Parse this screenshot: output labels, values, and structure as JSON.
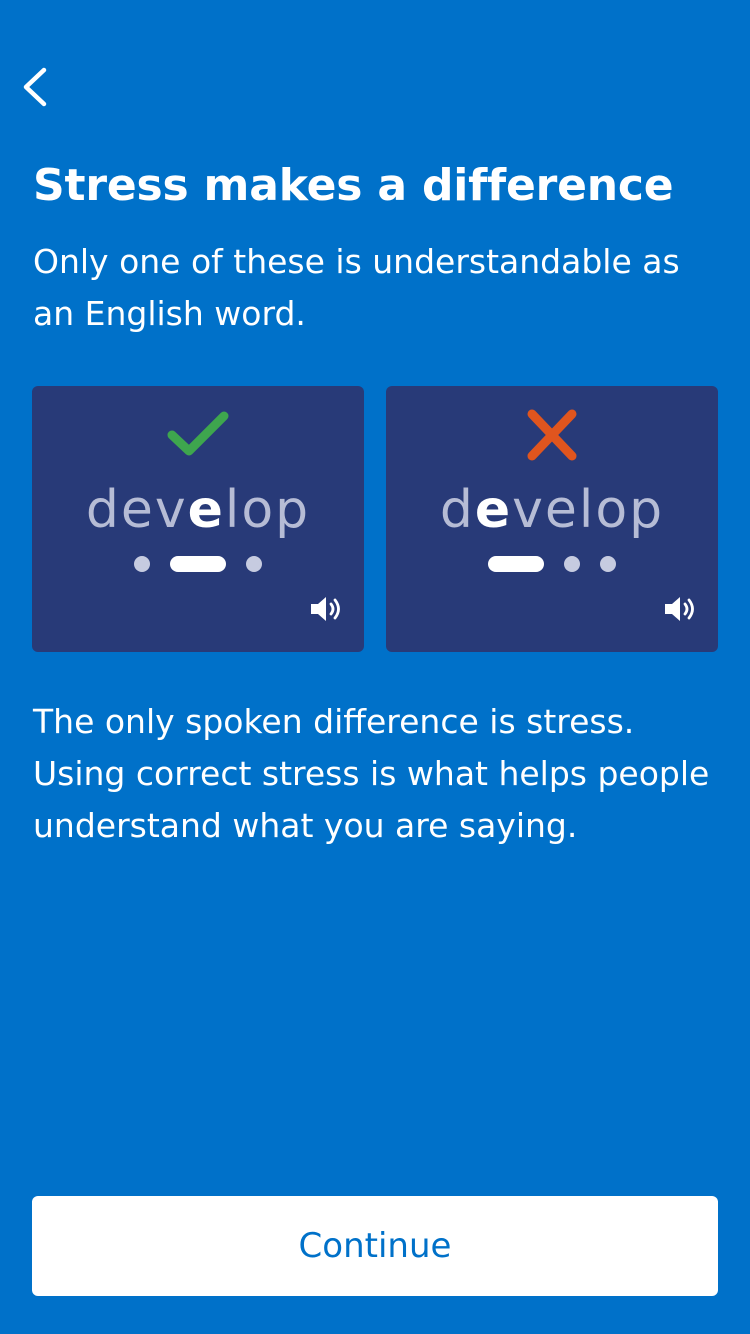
{
  "header": {
    "back_icon": "chevron-left-icon"
  },
  "title": "Stress makes a difference",
  "subtitle": "Only one of these is understandable as an English word.",
  "options": [
    {
      "status_icon": "checkmark-icon",
      "status_color": "#3ea64e",
      "word_before": "dev",
      "word_stressed": "e",
      "word_after": "lop",
      "stress_pattern": [
        "dot",
        "dash",
        "dot"
      ],
      "audio_icon": "speaker-icon"
    },
    {
      "status_icon": "cross-icon",
      "status_color": "#e0551e",
      "word_before": "d",
      "word_stressed": "e",
      "word_after": "velop",
      "stress_pattern": [
        "dash",
        "dot",
        "dot"
      ],
      "audio_icon": "speaker-icon"
    }
  ],
  "body_text": "The only spoken difference is stress. Using correct stress is what helps people understand what you are saying.",
  "continue_label": "Continue",
  "colors": {
    "background": "#0071c9",
    "card": "#283a78",
    "correct": "#3ea64e",
    "incorrect": "#e0551e"
  }
}
